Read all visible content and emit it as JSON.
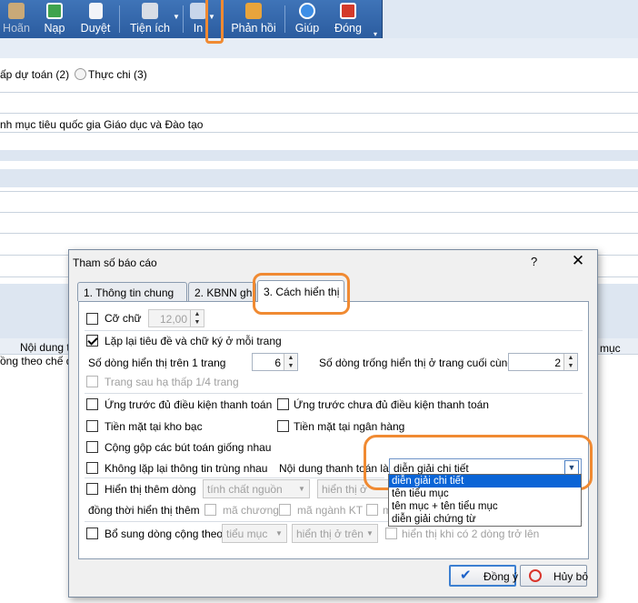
{
  "toolbar": {
    "items": [
      {
        "label": "Hoãn",
        "icon": "undo-icon"
      },
      {
        "label": "Nạp",
        "icon": "load-icon"
      },
      {
        "label": "Duyệt",
        "icon": "approve-icon"
      },
      {
        "label": "Tiện ích",
        "icon": "tools-icon"
      },
      {
        "label": "In",
        "icon": "print-icon"
      },
      {
        "label": "Phản hồi",
        "icon": "megaphone-icon"
      },
      {
        "label": "Giúp",
        "icon": "help-icon"
      },
      {
        "label": "Đóng",
        "icon": "close-icon"
      }
    ]
  },
  "background": {
    "radio1": "ấp dự toán (2)",
    "radio2": "Thực chi (3)",
    "program": "nh mục tiêu quốc gia Giáo dục và Đào tạo",
    "col1": "Nội dung th",
    "col2": "mục",
    "row1": "ồng theo chế đ"
  },
  "dialog": {
    "title": "Tham số báo cáo",
    "help": "?",
    "close": "✕",
    "tabs": [
      "1. Thông tin chung",
      "2. KBNN ghi",
      "3. Cách hiển thị"
    ],
    "font_label": "Cỡ chữ",
    "font_size": "12,00",
    "repeat_header": "Lặp lại tiêu đề và chữ ký ở mỗi trang",
    "rows_per_page_label": "Số dòng hiển thị trên 1 trang",
    "rows_per_page": "6",
    "blank_rows_label": "Số dòng trống hiển thị ở trang cuối cùng",
    "blank_rows": "2",
    "next_page": "Trang sau hạ thấp 1/4 trang",
    "adv_eligible": "Ứng trước đủ điều kiện thanh toán",
    "adv_not_eligible": "Ứng trước chưa đủ điều kiện thanh toán",
    "cash_treasury": "Tiền mặt tại kho bạc",
    "cash_bank": "Tiền mặt tại ngân hàng",
    "merge_entries": "Cộng gộp các bút toán giống nhau",
    "no_repeat": "Không lặp lại thông tin trùng nhau",
    "payment_content_label": "Nội dung thanh toán là",
    "payment_content_value": "diễn giải chi tiết",
    "payment_options": [
      "diễn giải chi tiết",
      "tên tiểu mục",
      "tên mục + tên tiểu mục",
      "diễn giải chứng từ"
    ],
    "show_extra_row": "Hiển thị thêm dòng",
    "extra_select1": "tính chất nguồn",
    "extra_select2": "hiển thị ở",
    "also_show": "đồng thời hiển thị thêm",
    "chapter_code": "mã chương",
    "sector_code": "mã ngành KT",
    "extra_cut": "m",
    "add_total": "Bổ sung dòng cộng theo",
    "total_select1": "tiểu mục",
    "total_select2": "hiển thị ở trên",
    "total_note": "hiển thị khi có 2 dòng trở lên",
    "ok": "Đồng ý",
    "cancel": "Hủy bỏ"
  },
  "colors": {
    "highlight": "#f08a32",
    "toolbar": "#2f62a6",
    "selection": "#0a64d6"
  }
}
